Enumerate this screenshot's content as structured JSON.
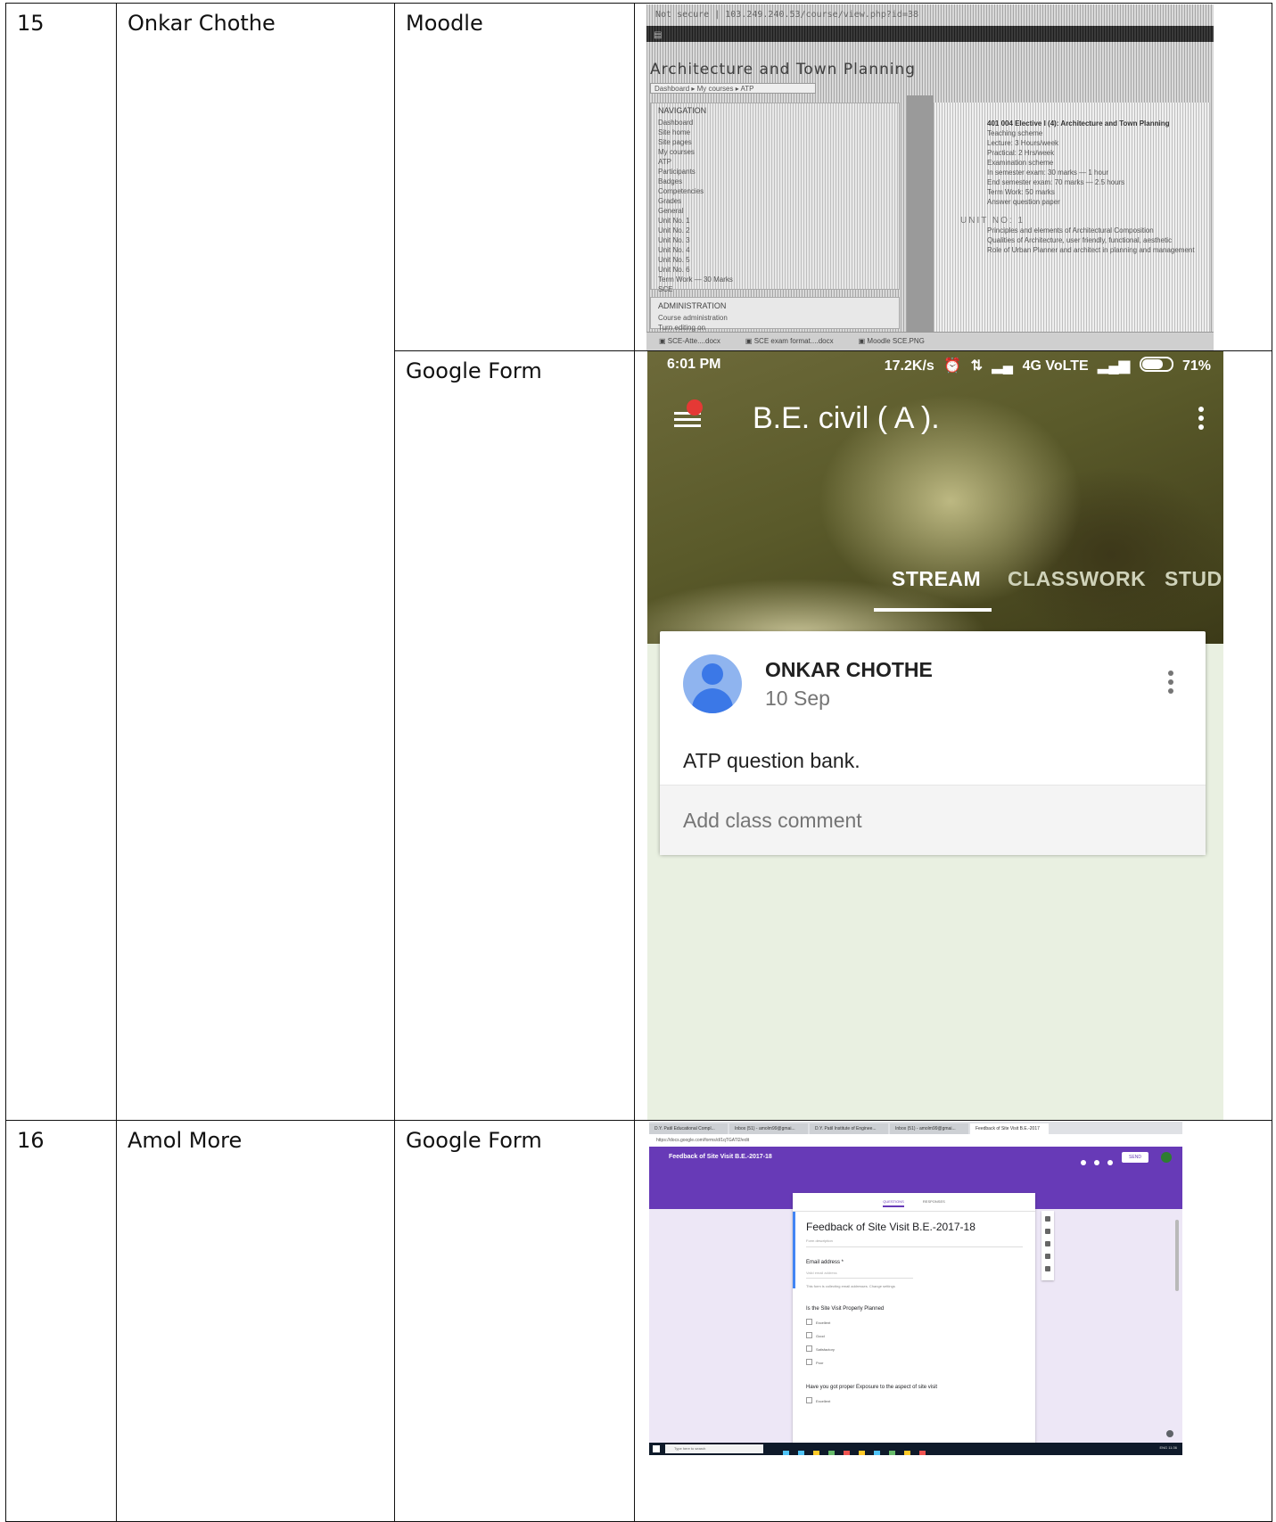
{
  "rows": [
    {
      "number": "15",
      "name": "Onkar Chothe",
      "entries": [
        {
          "platform": "Moodle",
          "screenshot": {
            "url_text": "Not secure | 103.249.240.53/course/view.php?id=38",
            "page_title": "Architecture and Town Planning",
            "breadcrumb": "Dashboard ▸ My courses ▸ ATP",
            "nav_heading": "NAVIGATION",
            "nav_items": [
              "Dashboard",
              "Site home",
              "Site pages",
              "My courses",
              "ATP",
              "Participants",
              "Badges",
              "Competencies",
              "Grades",
              "General",
              "Unit No. 1",
              "Unit No. 2",
              "Unit No. 3",
              "Unit No. 4",
              "Unit No. 5",
              "Unit No. 6",
              "Term Work — 30 Marks",
              "SCE"
            ],
            "admin_heading": "ADMINISTRATION",
            "admin_items": [
              "Course administration",
              "Turn editing on"
            ],
            "main_heading": "401 004 Elective I (4): Architecture and Town Planning",
            "main_lines": [
              "Teaching scheme",
              "Lecture: 3 Hours/week",
              "Practical: 2 Hrs/week",
              "Examination scheme",
              "In semester exam: 30 marks — 1 hour",
              "End semester exam: 70 marks — 2.5 hours",
              "Term Work: 50 marks",
              "Answer question paper"
            ],
            "unit_heading": "UNIT NO: 1",
            "unit_lines": [
              "Principles and elements of Architectural Composition",
              "Qualities of Architecture, user friendly, functional, aesthetic",
              "Role of Urban Planner and architect in planning and management"
            ],
            "downloads": [
              "SCE-Atte....docx",
              "SCE exam format....docx",
              "Moodle SCE.PNG"
            ]
          }
        },
        {
          "platform": "Google Form",
          "screenshot": {
            "status_time": "6:01 PM",
            "status_speed": "17.2K/s",
            "status_network": "4G VoLTE",
            "status_battery": "71%",
            "class_title": "B.E. civil ( A ).",
            "tabs": [
              "STREAM",
              "CLASSWORK",
              "STUD"
            ],
            "post_author": "ONKAR CHOTHE",
            "post_date": "10 Sep",
            "post_body": "ATP question bank.",
            "comment_placeholder": "Add class comment",
            "colors": {
              "accent_avatar": "#3b78e7",
              "notification_dot": "#e53935",
              "background": "#e9f0e1"
            }
          }
        }
      ]
    },
    {
      "number": "16",
      "name": "Amol More",
      "entries": [
        {
          "platform": "Google Form",
          "screenshot": {
            "browser_tabs": [
              "D.Y. Patil Educational Compl...",
              "Inbox (51) - amolm99@gmai...",
              "D.Y. Patil Institute of Enginee...",
              "Inbox (51) - amolm99@gmai...",
              "Feedback of Site Visit B.E.-2017"
            ],
            "address": "https://docs.google.com/forms/d/1qTGATl2/edit",
            "form_name_header": "Feedback of Site Visit B.E.-2017-18",
            "send_label": "SEND",
            "card_tabs": [
              "QUESTIONS",
              "RESPONSES"
            ],
            "form_title": "Feedback of Site Visit B.E.-2017-18",
            "form_description": "Form description",
            "email_label": "Email address *",
            "email_placeholder": "Valid email address",
            "email_note": "This form is collecting email addresses. Change settings",
            "question1": "Is the Site Visit Properly Planned",
            "options": [
              "Excellent",
              "Good",
              "Satisfactory",
              "Poor"
            ],
            "question2": "Have you got proper Exposure to the aspect of site visit",
            "question2_options": [
              "Excellent"
            ],
            "taskbar_search": "Type here to search",
            "tray_text": "ENG 11:36",
            "colors": {
              "header": "#673ab7",
              "background": "#ede7f6"
            }
          }
        }
      ]
    }
  ]
}
